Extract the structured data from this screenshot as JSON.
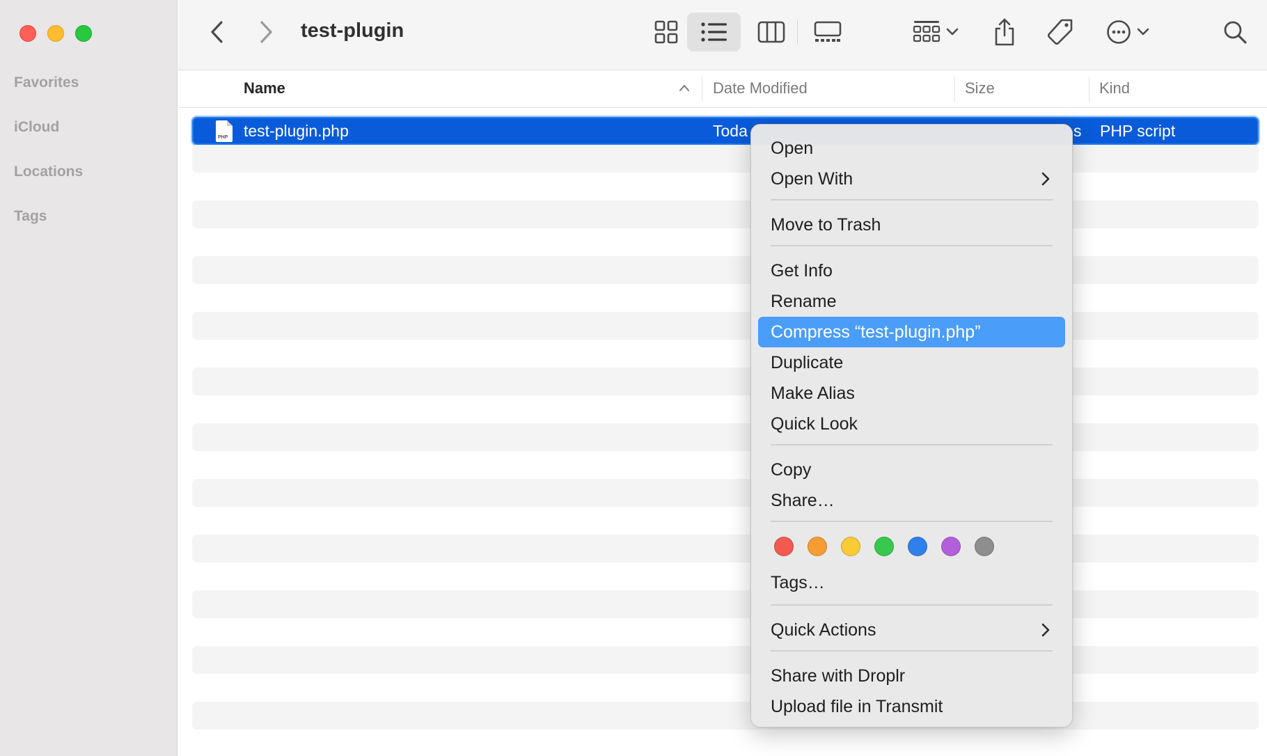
{
  "window": {
    "title": "test-plugin"
  },
  "sidebar": {
    "sections": [
      "Favorites",
      "iCloud",
      "Locations",
      "Tags"
    ]
  },
  "toolbar": {
    "icons": [
      "back-icon",
      "forward-icon",
      "icon-view-icon",
      "list-view-icon",
      "column-view-icon",
      "gallery-view-icon",
      "group-icon",
      "share-icon",
      "tag-icon",
      "more-icon",
      "search-icon"
    ],
    "active_view": "list"
  },
  "columns": {
    "name": "Name",
    "date_modified": "Date Modified",
    "size": "Size",
    "kind": "Kind"
  },
  "file": {
    "name": "test-plugin.php",
    "date_partial": "Toda",
    "size_partial": "s",
    "kind": "PHP script",
    "icon_label": "PHP"
  },
  "context_menu": {
    "items": {
      "open": "Open",
      "open_with": "Open With",
      "move_to_trash": "Move to Trash",
      "get_info": "Get Info",
      "rename": "Rename",
      "compress": "Compress “test-plugin.php”",
      "duplicate": "Duplicate",
      "make_alias": "Make Alias",
      "quick_look": "Quick Look",
      "copy": "Copy",
      "share": "Share…",
      "tags": "Tags…",
      "quick_actions": "Quick Actions",
      "share_droplr": "Share with Droplr",
      "upload_transmit": "Upload file in Transmit"
    },
    "highlighted": "compress",
    "tag_colors": [
      "#f25a51",
      "#f59d32",
      "#f9cb35",
      "#38c84e",
      "#2f80ed",
      "#b35fdc",
      "#8e8e8e"
    ]
  }
}
